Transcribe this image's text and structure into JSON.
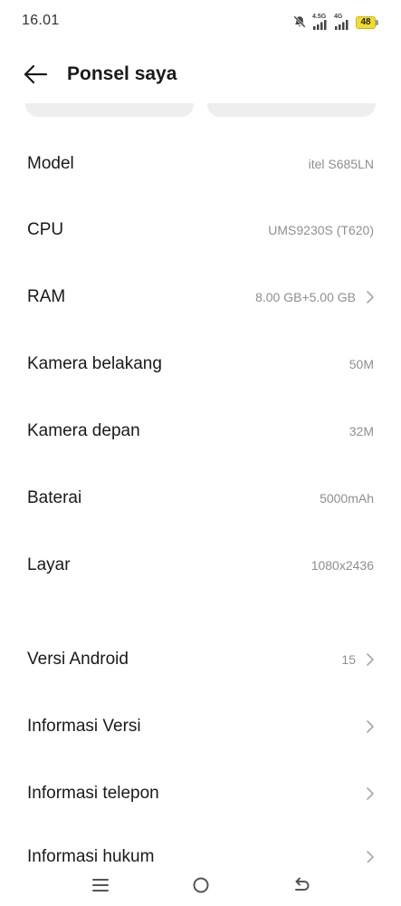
{
  "status_bar": {
    "time": "16.01",
    "icons": [
      "mute-notification-icon",
      "signal-4-5g-icon",
      "signal-4g-icon",
      "battery-icon"
    ],
    "network_1": "4.5G",
    "network_2": "4G",
    "battery_level": "48",
    "battery_color": "#f3dd2c"
  },
  "header": {
    "back_icon": "arrow-left-icon",
    "title": "Ponsel saya"
  },
  "specs": [
    {
      "label": "Model",
      "value": "itel S685LN"
    },
    {
      "label": "CPU",
      "value": "UMS9230S (T620)"
    },
    {
      "label": "RAM",
      "value": "8.00 GB+5.00 GB"
    },
    {
      "label": "Kamera belakang",
      "value": "50M"
    },
    {
      "label": "Kamera depan",
      "value": "32M"
    },
    {
      "label": "Baterai",
      "value": "5000mAh"
    },
    {
      "label": "Layar",
      "value": "1080x2436"
    }
  ],
  "info": [
    {
      "label": "Versi Android",
      "value": "15"
    },
    {
      "label": "Informasi Versi",
      "value": ""
    },
    {
      "label": "Informasi telepon",
      "value": ""
    },
    {
      "label": "Informasi hukum",
      "value": ""
    }
  ],
  "nav_bar": {
    "icons": [
      "menu-icon",
      "home-icon",
      "back-icon"
    ]
  }
}
